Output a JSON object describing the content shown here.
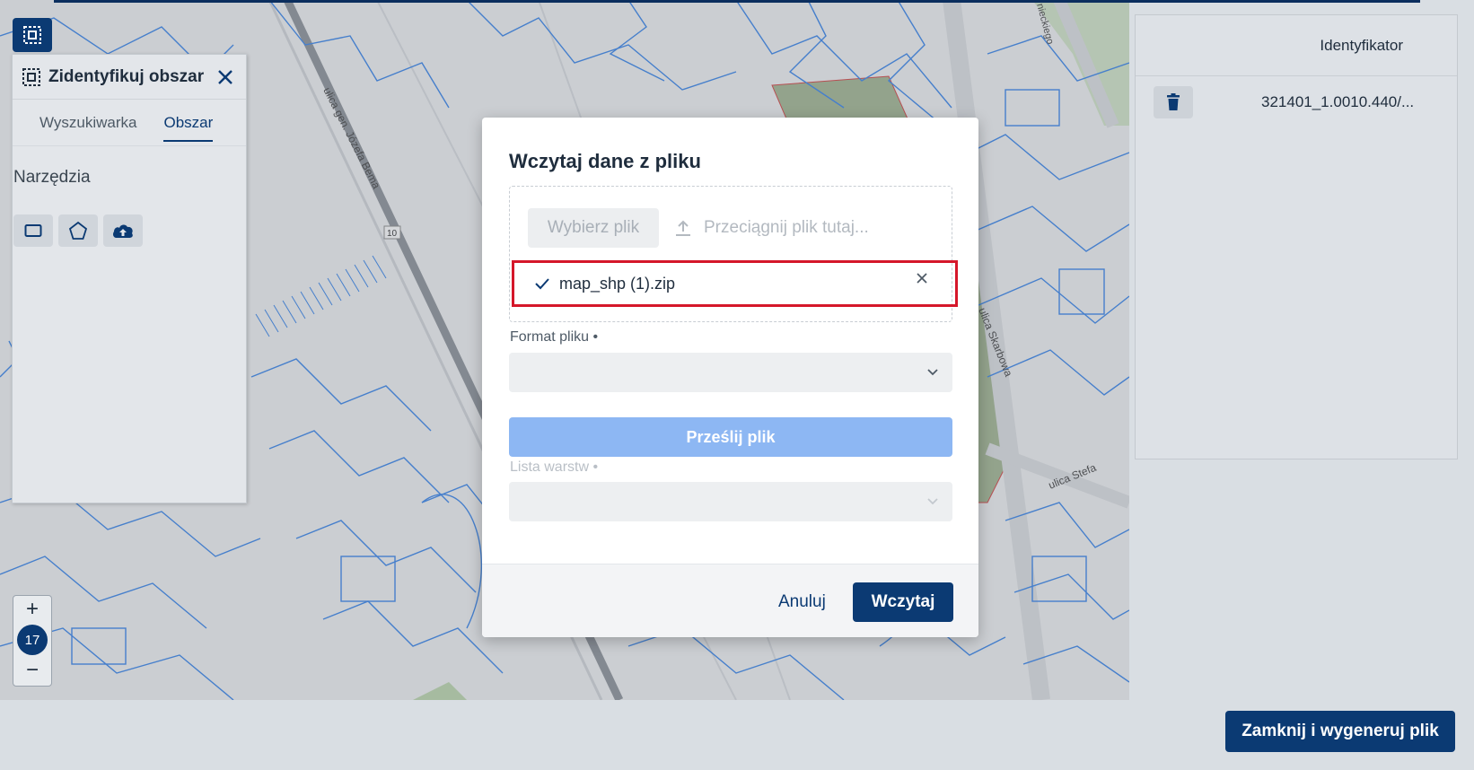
{
  "map": {
    "street_label_1": "ulica gen. Józefa Bema",
    "street_label_2": "ulica Skarbowa",
    "street_label_3": "ulica Stefa",
    "street_label_4": "nieckiego",
    "house_number": "10",
    "zoom_level": "17",
    "zoom_in": "+",
    "zoom_out": "−"
  },
  "left_panel": {
    "title": "Zidentyfikuj obszar",
    "tabs": [
      {
        "label": "Wyszukiwarka",
        "active": false
      },
      {
        "label": "Obszar",
        "active": true
      }
    ],
    "section_title": "Narzędzia",
    "tools": [
      "rectangle-icon",
      "pentagon-icon",
      "cloud-upload-icon"
    ]
  },
  "right_panel": {
    "column_header": "Identyfikator",
    "rows": [
      {
        "value": "321401_1.0010.440/..."
      }
    ]
  },
  "generate_button": "Zamknij i wygeneruj plik",
  "modal": {
    "title": "Wczytaj dane z pliku",
    "choose_file": "Wybierz plik",
    "drop_hint": "Przeciągnij plik tutaj...",
    "file_name": "map_shp (1).zip",
    "format_label": "Format pliku",
    "format_value": "",
    "upload_button": "Prześlij plik",
    "layers_label": "Lista warstw",
    "layers_value": "",
    "cancel": "Anuluj",
    "submit": "Wczytaj"
  },
  "colors": {
    "primary": "#0b3a73",
    "upload_disabled": "#8db7f3",
    "highlight": "#d5172a",
    "parcel_lines": "#3b82e0"
  }
}
